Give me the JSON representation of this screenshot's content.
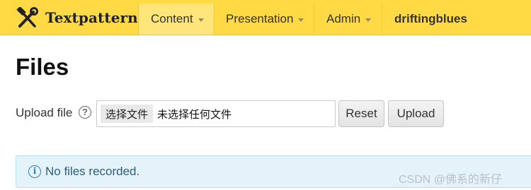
{
  "header": {
    "brand": "Textpattern",
    "nav": [
      {
        "label": "Content",
        "has_menu": true,
        "active": true
      },
      {
        "label": "Presentation",
        "has_menu": true,
        "active": false
      },
      {
        "label": "Admin",
        "has_menu": true,
        "active": false
      }
    ],
    "site_name": "driftingblues",
    "brand_icon": "hammer-wrench-icon"
  },
  "page": {
    "title": "Files",
    "upload": {
      "label": "Upload file",
      "help_icon": "help-circle-icon",
      "choose_button": "选择文件",
      "file_status": "未选择任何文件",
      "reset_label": "Reset",
      "upload_label": "Upload"
    },
    "notice": {
      "icon": "info-icon",
      "text": "No files recorded."
    }
  },
  "watermark": "CSDN @佛系的新仔",
  "colors": {
    "topbar": "#ffda44",
    "active_nav": "#ffe57a",
    "notice_bg": "#e4f3fa",
    "notice_text": "#2d5f7a"
  }
}
